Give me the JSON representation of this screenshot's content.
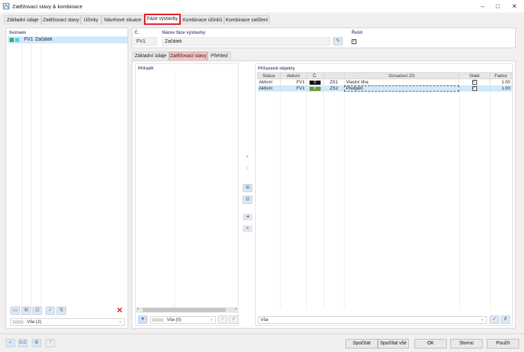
{
  "window": {
    "title": "Zatěžovací stavy & kombinace",
    "minimize": "–",
    "maximize": "□",
    "close": "✕"
  },
  "tabs": [
    {
      "label": "Základní údaje"
    },
    {
      "label": "Zatěžovací stavy"
    },
    {
      "label": "Účinky"
    },
    {
      "label": "Návrhové situace"
    },
    {
      "label": "Fáze výstavby"
    },
    {
      "label": "Kombinace účinků"
    },
    {
      "label": "Kombinace zatížení"
    }
  ],
  "list": {
    "header": "Seznam",
    "items": [
      {
        "code": "FV1",
        "name": "Začátek"
      }
    ],
    "filter": "Vše (2)"
  },
  "detail": {
    "number_label": "Č.",
    "number_value": "FV1",
    "name_label": "Název fáze výstavby",
    "name_value": "Začátek",
    "solve_label": "Řešit"
  },
  "subtabs": [
    {
      "label": "Základní údaje"
    },
    {
      "label": "Zatěžovací stavy"
    },
    {
      "label": "Přehled"
    }
  ],
  "assign": {
    "header": "Přiřadit",
    "filter": "Vše (0)"
  },
  "assigned": {
    "header": "Přiřazené objekty",
    "columns": [
      "Status",
      "Aktivní",
      "Č.",
      "",
      "Označení ZS",
      "Stálé",
      "Faktor"
    ],
    "rows": [
      {
        "status": "Aktivní",
        "active": "FV1",
        "tag": "G",
        "tag_color": "#111111",
        "no": "ZS1",
        "name": "Vlastní tíha",
        "permanent": true,
        "factor": "1.00"
      },
      {
        "status": "Aktivní",
        "active": "FV1",
        "tag": "P",
        "tag_color": "#6a9a3a",
        "no": "ZS2",
        "name": "Předpětí",
        "permanent": true,
        "factor": "1.00"
      }
    ],
    "filter": "Vše"
  },
  "footer": {
    "calculate": "Spočítat",
    "calculate_all": "Spočítat vše",
    "ok": "OK",
    "cancel": "Storno",
    "apply": "Použít"
  }
}
